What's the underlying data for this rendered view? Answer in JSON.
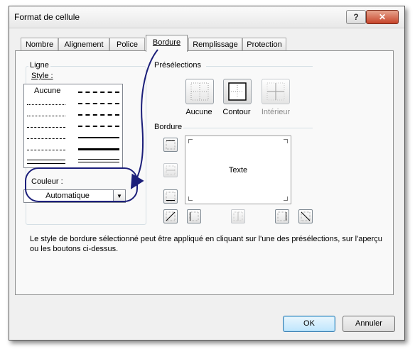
{
  "window": {
    "title": "Format de cellule",
    "help_glyph": "?",
    "close_glyph": "✕"
  },
  "tabs": [
    {
      "label": "Nombre"
    },
    {
      "label": "Alignement"
    },
    {
      "label": "Police"
    },
    {
      "label": "Bordure",
      "selected": true
    },
    {
      "label": "Remplissage"
    },
    {
      "label": "Protection"
    }
  ],
  "line_group": {
    "title": "Ligne",
    "style_label": "Style :",
    "none_option": "Aucune",
    "color_label": "Couleur :",
    "color_value": "Automatique"
  },
  "presets": {
    "title": "Présélections",
    "items": [
      {
        "label": "Aucune",
        "enabled": true
      },
      {
        "label": "Contour",
        "enabled": true
      },
      {
        "label": "Intérieur",
        "enabled": false
      }
    ]
  },
  "border": {
    "title": "Bordure",
    "preview_text": "Texte"
  },
  "description": "Le style de bordure sélectionné peut être appliqué en cliquant sur l'une des présélections, sur l'aperçu ou les boutons ci-dessus.",
  "buttons": {
    "ok": "OK",
    "cancel": "Annuler"
  },
  "annotation_color": "#1c1f7a"
}
